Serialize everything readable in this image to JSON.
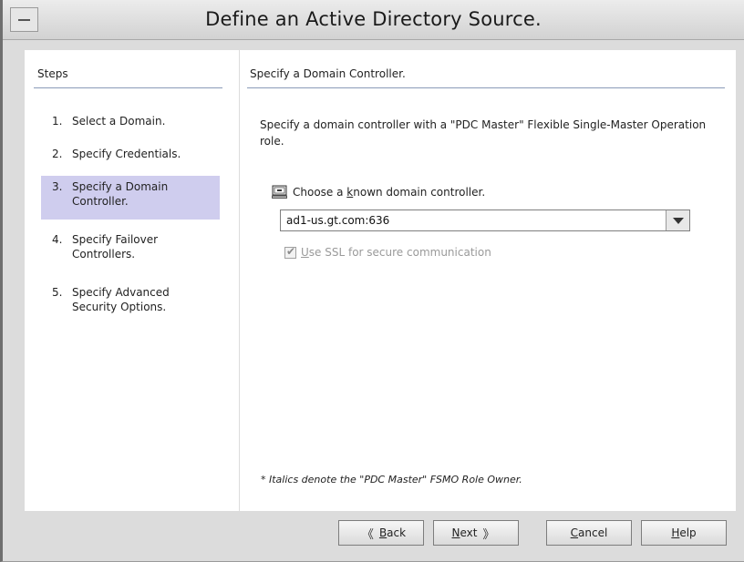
{
  "window": {
    "title": "Define an Active Directory Source."
  },
  "steps": {
    "heading": "Steps",
    "items": [
      {
        "num": "1.",
        "line1": "Select a Domain.",
        "line2": ""
      },
      {
        "num": "2.",
        "line1": "Specify Credentials.",
        "line2": ""
      },
      {
        "num": "3.",
        "line1": "Specify a Domain",
        "line2": "Controller."
      },
      {
        "num": "4.",
        "line1": "Specify Failover",
        "line2": "Controllers."
      },
      {
        "num": "5.",
        "line1": "Specify Advanced",
        "line2": "Security Options."
      }
    ],
    "active_index": 3
  },
  "content": {
    "heading": "Specify a Domain Controller.",
    "description": "Specify a domain controller with a \"PDC Master\" Flexible Single-Master Operation role.",
    "choose_label": "Choose a known domain controller.",
    "choose_prefix": "Choose a ",
    "choose_mnemonic": "k",
    "choose_suffix": "nown domain controller.",
    "controller_value": "ad1-us.gt.com:636",
    "ssl_mnemonic": "U",
    "ssl_suffix": "se SSL for secure communication",
    "ssl_checked": true,
    "footnote": "* Italics denote the \"PDC Master\" FSMO Role Owner."
  },
  "buttons": {
    "back_mnemonic": "B",
    "back_rest": "ack",
    "next_mnemonic": "N",
    "next_rest": "ext",
    "cancel_mnemonic": "C",
    "cancel_rest": "ancel",
    "help_mnemonic": "H",
    "help_rest": "elp"
  }
}
